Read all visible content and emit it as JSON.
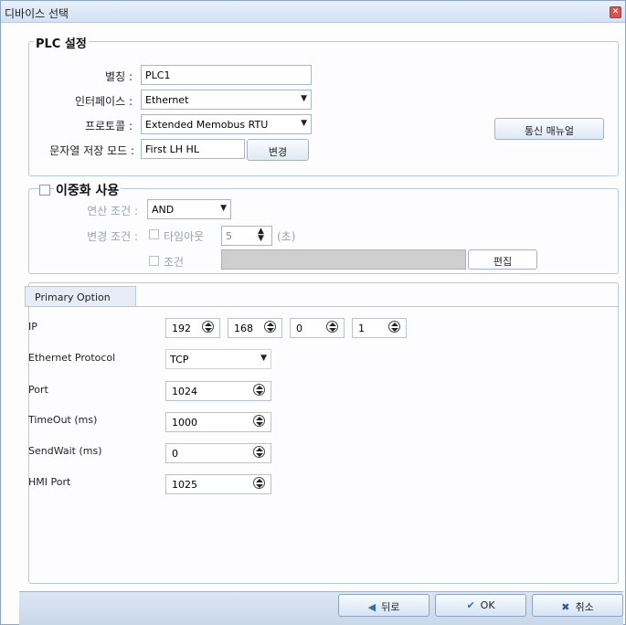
{
  "window": {
    "title": "디바이스 선택"
  },
  "plc": {
    "group_title": "PLC 설정",
    "alias_label": "별칭 :",
    "alias_value": "PLC1",
    "interface_label": "인터페이스 :",
    "interface_value": "Ethernet",
    "protocol_label": "프로토콜 :",
    "protocol_value": "Extended Memobus RTU",
    "manual_button": "통신 매뉴얼",
    "string_mode_label": "문자열 저장 모드 :",
    "string_mode_value": "First LH HL",
    "change_button": "변경"
  },
  "redundancy": {
    "group_title": "이중화 사용",
    "op_label": "연산 조건 :",
    "op_value": "AND",
    "change_cond_label": "변경 조건 :",
    "timeout_label": "타임아웃",
    "timeout_value": "5",
    "timeout_unit": "(초)",
    "condition_label": "조건",
    "edit_button": "편집"
  },
  "tabs": {
    "primary": "Primary Option"
  },
  "options": {
    "ip_label": "IP",
    "ip": [
      "192",
      "168",
      "0",
      "1"
    ],
    "protocol_label": "Ethernet Protocol",
    "protocol_value": "TCP",
    "port_label": "Port",
    "port_value": "1024",
    "timeout_label": "TimeOut (ms)",
    "timeout_value": "1000",
    "sendwait_label": "SendWait (ms)",
    "sendwait_value": "0",
    "hmiport_label": "HMI Port",
    "hmiport_value": "1025"
  },
  "footer": {
    "back": "뒤로",
    "ok": "OK",
    "cancel": "취소"
  },
  "colors": {
    "accent": "#2f6fb3",
    "ok_check": "#2f6fb3",
    "cancel_x": "#2b5b9b"
  }
}
